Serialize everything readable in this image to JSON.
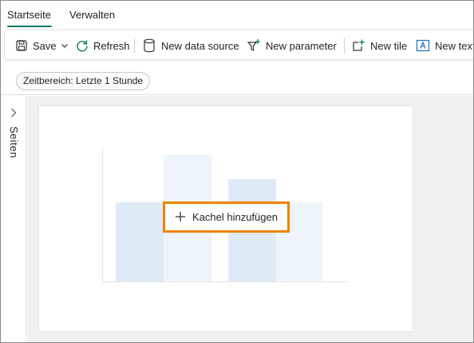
{
  "tabs": [
    {
      "label": "Startseite",
      "active": true
    },
    {
      "label": "Verwalten",
      "active": false
    }
  ],
  "toolbar": {
    "save_label": "Save",
    "refresh_label": "Refresh",
    "new_data_source_label": "New data source",
    "new_parameter_label": "New parameter",
    "new_tile_label": "New tile",
    "new_text_label": "New text"
  },
  "filter": {
    "time_range_label": "Zeitbereich: Letzte 1 Stunde"
  },
  "side_panel": {
    "label": "Seiten"
  },
  "canvas": {
    "add_tile_label": "Kachel hinzufügen"
  },
  "colors": {
    "accent": "#117865",
    "highlight": "#f08200",
    "bar_dark": "#dfeaf7",
    "bar_light": "#eef4fb"
  }
}
